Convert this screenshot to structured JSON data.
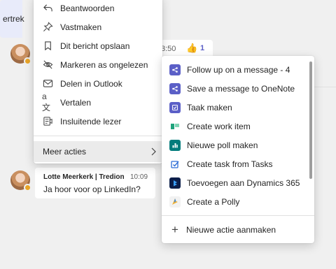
{
  "context_menu": {
    "items": [
      {
        "label": "Beantwoorden",
        "icon": "reply-icon"
      },
      {
        "label": "Vastmaken",
        "icon": "pin-icon"
      },
      {
        "label": "Dit bericht opslaan",
        "icon": "bookmark-icon"
      },
      {
        "label": "Markeren as ongelezen",
        "icon": "unread-icon"
      },
      {
        "label": "Delen in Outlook",
        "icon": "mail-icon"
      },
      {
        "label": "Vertalen",
        "icon": "translate-icon"
      },
      {
        "label": "Insluitende lezer",
        "icon": "immersive-reader-icon"
      }
    ],
    "more_actions": "Meer acties"
  },
  "message_top": {
    "time": "3:50",
    "reaction": "👍",
    "count": "1"
  },
  "message_right": {
    "text": "ertrek"
  },
  "message_bottom": {
    "author": "Lotte Meerkerk | Tredion",
    "time": "10:09",
    "text": "Ja hoor voor op LinkedIn?"
  },
  "submenu": {
    "items": [
      {
        "label": "Follow up on a message - 4",
        "icon": "workflow-icon",
        "color": "#5b5fc7"
      },
      {
        "label": "Save a message to OneNote",
        "icon": "workflow-icon",
        "color": "#5b5fc7"
      },
      {
        "label": "Taak maken",
        "icon": "planner-icon",
        "color": "#5b5fc7"
      },
      {
        "label": "Create work item",
        "icon": "azure-boards-icon",
        "color": "#1fa37c"
      },
      {
        "label": "Nieuwe poll maken",
        "icon": "forms-poll-icon",
        "color": "#037c7c"
      },
      {
        "label": "Create task from Tasks",
        "icon": "tasks-icon",
        "color": "#2b6cd6"
      },
      {
        "label": "Toevoegen aan Dynamics 365",
        "icon": "dynamics-icon",
        "color": "#0b1e4a"
      },
      {
        "label": "Create a Polly",
        "icon": "polly-icon",
        "color": "#f2f2f2"
      }
    ],
    "new_action": "Nieuwe actie aanmaken"
  }
}
